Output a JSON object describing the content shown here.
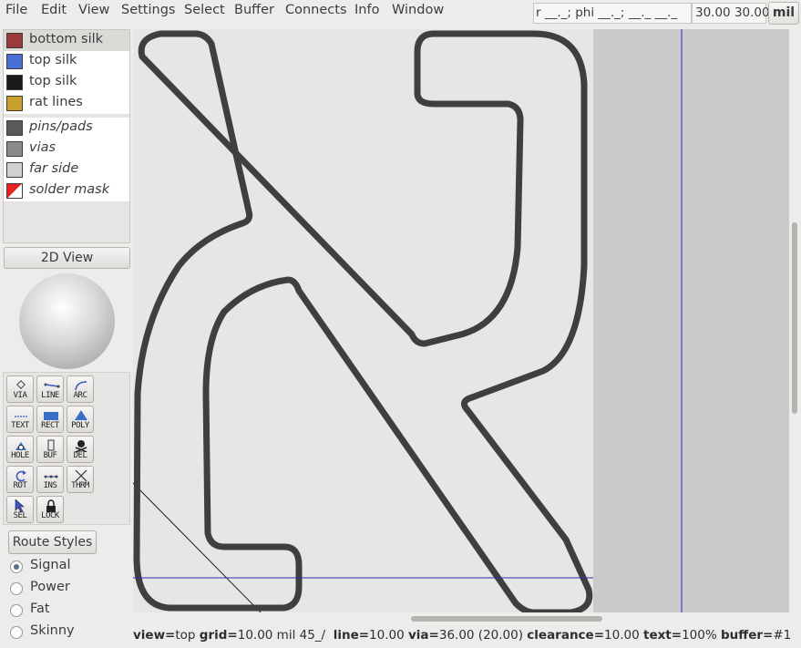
{
  "menubar": {
    "items": [
      "File",
      "Edit",
      "View",
      "Settings",
      "Select",
      "Buffer",
      "Connects",
      "Info",
      "Window"
    ],
    "coord_readout": "r __._; phi __._; __._ __._",
    "cursor_position": "30.00 30.00",
    "unit_label": "mil"
  },
  "layers": [
    {
      "label": "bottom silk",
      "color": "#9b3a3a",
      "italic": false,
      "selected": true
    },
    {
      "label": "top silk",
      "color": "#4a6fd4",
      "italic": false,
      "selected": false
    },
    {
      "label": "top silk",
      "color": "#1a1a1a",
      "italic": false,
      "selected": false
    },
    {
      "label": "rat lines",
      "color": "#c8a02e",
      "italic": false,
      "selected": false
    },
    {
      "label": "pins/pads",
      "color": "#5a5a5a",
      "italic": true,
      "selected": false
    },
    {
      "label": "vias",
      "color": "#8a8a8a",
      "italic": true,
      "selected": false
    },
    {
      "label": "far side",
      "color": "#d0d0d0",
      "italic": true,
      "selected": false
    },
    {
      "label": "solder mask",
      "color": "#e82020",
      "italic": true,
      "selected": false
    }
  ],
  "view_button_label": "2D View",
  "tools": [
    {
      "label": "VIA",
      "icon": "via-icon"
    },
    {
      "label": "LINE",
      "icon": "line-icon"
    },
    {
      "label": "ARC",
      "icon": "arc-icon"
    },
    {
      "label": "TEXT",
      "icon": "text-icon"
    },
    {
      "label": "RECT",
      "icon": "rect-icon"
    },
    {
      "label": "POLY",
      "icon": "poly-icon"
    },
    {
      "label": "HOLE",
      "icon": "hole-icon"
    },
    {
      "label": "BUF",
      "icon": "buffer-icon"
    },
    {
      "label": "DEL",
      "icon": "delete-icon"
    },
    {
      "label": "ROT",
      "icon": "rotate-icon"
    },
    {
      "label": "INS",
      "icon": "insert-icon"
    },
    {
      "label": "THRM",
      "icon": "thermal-icon"
    },
    {
      "label": "SEL",
      "icon": "select-arrow-icon"
    },
    {
      "label": "LOCK",
      "icon": "lock-icon"
    }
  ],
  "route_styles": {
    "button_label": "Route Styles",
    "options": [
      "Signal",
      "Power",
      "Fat",
      "Skinny"
    ],
    "selected": "Signal"
  },
  "status": {
    "view_key": "view=",
    "view_val": "top",
    "grid_key": "grid=",
    "grid_val": "10.00 mil",
    "angle": "45_/",
    "line_key": "line=",
    "line_val": "10.00",
    "via_key": "via=",
    "via_val": "36.00 (20.00)",
    "clearance_key": "clearance=",
    "clearance_val": "10.00",
    "text_key": "text=",
    "text_val": "100%",
    "buffer_key": "buffer=",
    "buffer_val": "#1"
  },
  "colors": {
    "board_area": "#e6e6e6",
    "outside_area": "#cacaca",
    "outline": "#3f3f3f",
    "crosshair": "#2b2bb0"
  }
}
